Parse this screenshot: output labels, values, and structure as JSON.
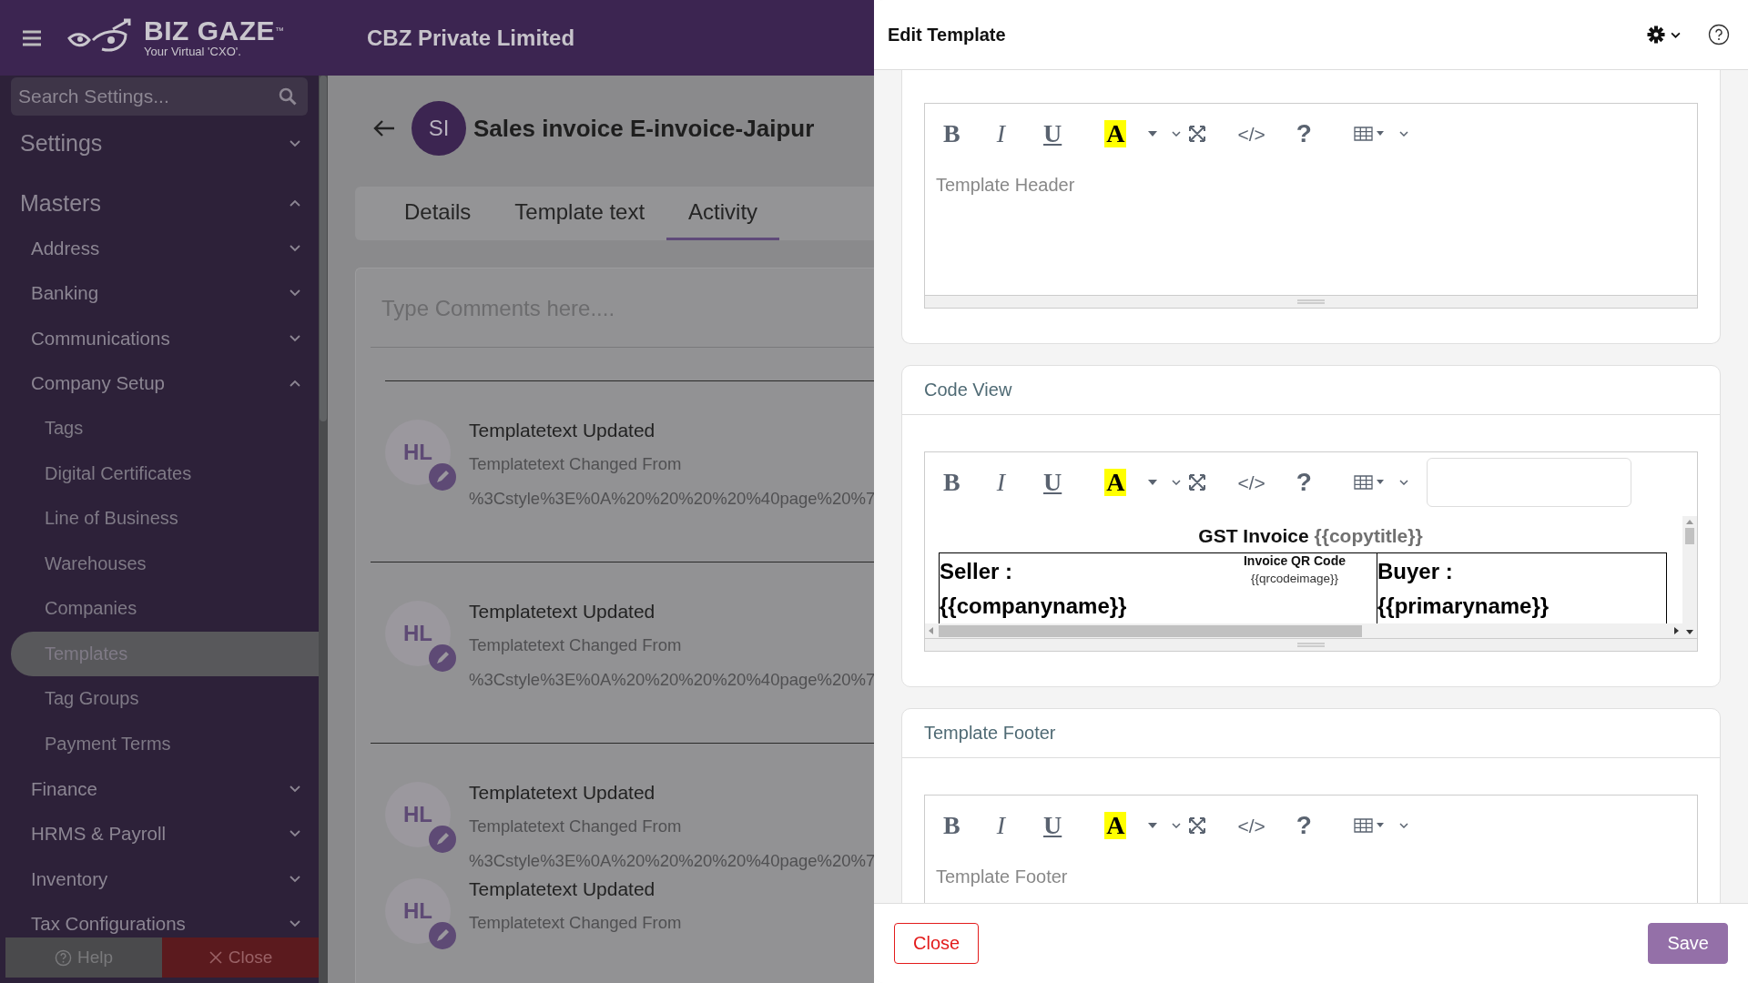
{
  "header": {
    "logo_name": "BIZ GAZE",
    "logo_tm": "™",
    "logo_tagline": "Your Virtual 'CXO'.",
    "company": "CBZ Private Limited"
  },
  "sidebar": {
    "search": {
      "placeholder": "Search Settings..."
    },
    "items": [
      {
        "label": "Settings",
        "expanded": false
      },
      {
        "label": "Masters",
        "expanded": true,
        "children": [
          {
            "label": "Address",
            "expanded": false
          },
          {
            "label": "Banking",
            "expanded": false
          },
          {
            "label": "Communications",
            "expanded": false
          },
          {
            "label": "Company Setup",
            "expanded": true,
            "children": [
              {
                "label": "Tags",
                "selected": false
              },
              {
                "label": "Digital Certificates",
                "selected": false
              },
              {
                "label": "Line of Business",
                "selected": false
              },
              {
                "label": "Warehouses",
                "selected": false
              },
              {
                "label": "Companies",
                "selected": false
              },
              {
                "label": "Templates",
                "selected": true
              },
              {
                "label": "Tag Groups",
                "selected": false
              },
              {
                "label": "Payment Terms",
                "selected": false
              }
            ]
          },
          {
            "label": "Finance",
            "expanded": false
          },
          {
            "label": "HRMS & Payroll",
            "expanded": false
          },
          {
            "label": "Inventory",
            "expanded": false
          },
          {
            "label": "Tax Configurations",
            "expanded": false
          }
        ]
      }
    ],
    "footer": [
      {
        "kind": "help",
        "label": "Help"
      },
      {
        "kind": "close",
        "label": "Close"
      }
    ]
  },
  "record": {
    "initials": "SI",
    "title": "Sales invoice E-invoice-Jaipur",
    "tabs": [
      {
        "label": "Details",
        "selected": false
      },
      {
        "label": "Template text",
        "selected": false
      },
      {
        "label": "Activity",
        "selected": true
      }
    ],
    "comment": {
      "placeholder": "Type Comments here...."
    },
    "activity": [
      {
        "initials": "HL",
        "title": "Templatetext Updated",
        "detail": "Templatetext Changed From",
        "value": "%3Cstyle%3E%0A%20%20%20%20%40page%20%7"
      },
      {
        "initials": "HL",
        "title": "Templatetext Updated",
        "detail": "Templatetext Changed From",
        "value": "%3Cstyle%3E%0A%20%20%20%20%40page%20%7"
      },
      {
        "initials": "HL",
        "title": "Templatetext Updated",
        "detail": "Templatetext Changed From",
        "value": "%3Cstyle%3E%0A%20%20%20%20%40page%20%7"
      },
      {
        "initials": "HL",
        "title": "Templatetext Updated",
        "detail": "Templatetext Changed From"
      }
    ]
  },
  "drawer": {
    "title": "Edit Template",
    "sections": [
      {
        "kind": "header",
        "editor": {
          "placeholder": "Template Header",
          "toolbar": [
            {
              "kind": "bold",
              "label": "B"
            },
            {
              "kind": "italic",
              "label": "I"
            },
            {
              "kind": "underline",
              "label": "U"
            },
            {
              "kind": "color",
              "label": "A"
            },
            {
              "kind": "caret"
            },
            {
              "kind": "chevron"
            },
            {
              "kind": "fullscreen"
            },
            {
              "kind": "code",
              "label": "</>"
            },
            {
              "kind": "help",
              "label": "?"
            },
            {
              "kind": "table"
            },
            {
              "kind": "chevron"
            }
          ]
        }
      },
      {
        "kind": "code",
        "title": "Code View",
        "editor": {
          "toolbar": [
            {
              "kind": "bold",
              "label": "B"
            },
            {
              "kind": "italic",
              "label": "I"
            },
            {
              "kind": "underline",
              "label": "U"
            },
            {
              "kind": "color",
              "label": "A"
            },
            {
              "kind": "caret"
            },
            {
              "kind": "chevron"
            },
            {
              "kind": "fullscreen"
            },
            {
              "kind": "code",
              "label": "</>"
            },
            {
              "kind": "help",
              "label": "?"
            },
            {
              "kind": "table"
            },
            {
              "kind": "chevron"
            },
            {
              "kind": "input"
            }
          ],
          "content": {
            "heading": "GST Invoice",
            "heading_var": "{{copytitle}}",
            "seller_label": "Seller :",
            "seller_var": "{{companyname}}",
            "qr_label": "Invoice QR Code",
            "qr_var": "{{qrcodeimage}}",
            "buyer_label": "Buyer :",
            "buyer_var": "{{primaryname}}"
          }
        }
      },
      {
        "kind": "footer",
        "title": "Template Footer",
        "editor": {
          "placeholder": "Template Footer",
          "toolbar": [
            {
              "kind": "bold",
              "label": "B"
            },
            {
              "kind": "italic",
              "label": "I"
            },
            {
              "kind": "underline",
              "label": "U"
            },
            {
              "kind": "color",
              "label": "A"
            },
            {
              "kind": "caret"
            },
            {
              "kind": "chevron"
            },
            {
              "kind": "fullscreen"
            },
            {
              "kind": "code",
              "label": "</>"
            },
            {
              "kind": "help",
              "label": "?"
            },
            {
              "kind": "table"
            },
            {
              "kind": "chevron"
            }
          ]
        }
      }
    ],
    "buttons": [
      {
        "kind": "close",
        "label": "Close"
      },
      {
        "kind": "save",
        "label": "Save"
      }
    ]
  }
}
